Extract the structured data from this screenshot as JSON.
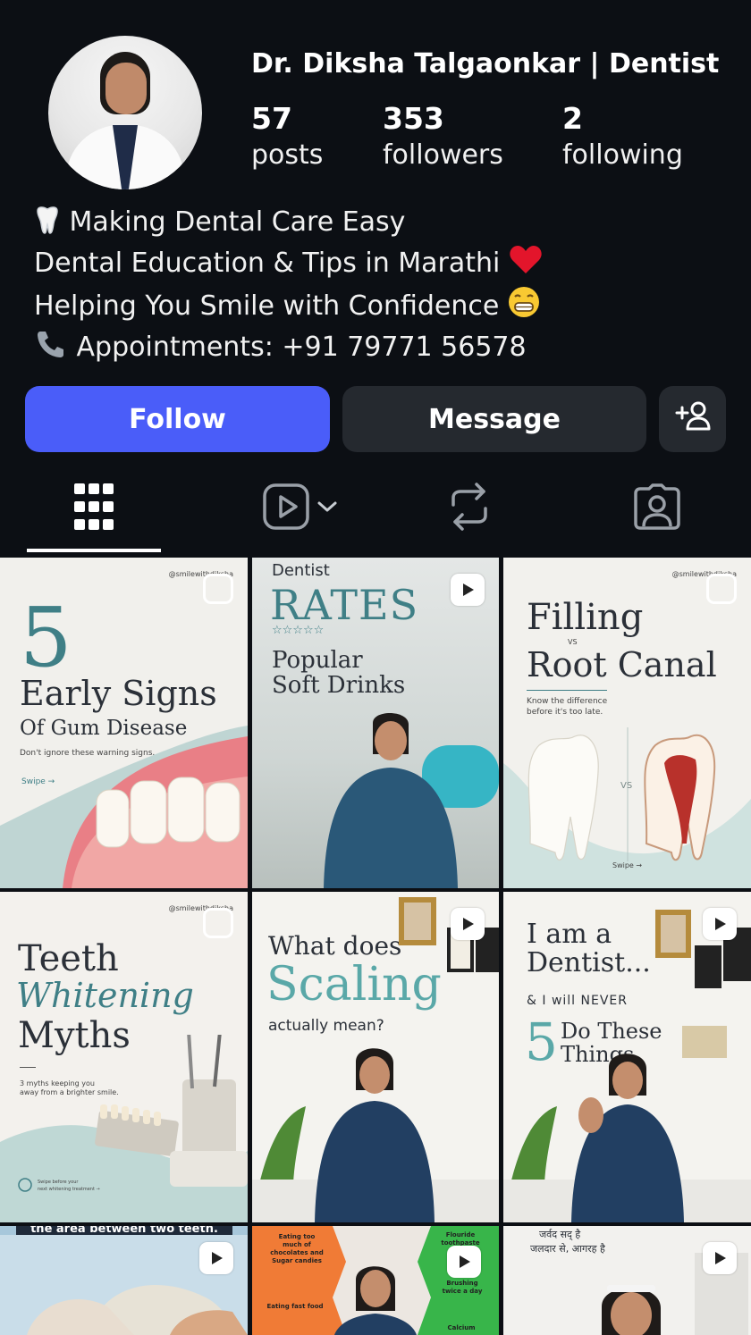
{
  "profile": {
    "name": "Dr. Diksha Talgaonkar | Dentist",
    "stats": [
      {
        "num": "57",
        "label": "posts"
      },
      {
        "num": "353",
        "label": "followers"
      },
      {
        "num": "2",
        "label": "following"
      }
    ],
    "bio": [
      {
        "icon": "tooth-icon",
        "text": " Making Dental Care Easy",
        "suffix": ""
      },
      {
        "icon": "",
        "text": "Dental Education & Tips in Marathi ",
        "suffix": "heart-icon"
      },
      {
        "icon": "",
        "text": "Helping You Smile with Confidence ",
        "suffix": "grin-icon"
      },
      {
        "icon": "phone-icon",
        "text": " Appointments: +91 79771 56578",
        "suffix": ""
      }
    ]
  },
  "actions": {
    "follow_label": "Follow",
    "message_label": "Message",
    "follow_color": "#4a5df9"
  },
  "tabs": {
    "icons": [
      "grid-icon",
      "reels-icon",
      "reposts-icon",
      "tagged-icon"
    ],
    "active": "grid-icon"
  },
  "posts": [
    {
      "type": "carousel",
      "title_num": "5",
      "title": "Early Signs",
      "subtitle": "Of Gum Disease",
      "caption": "Don't ignore these warning signs.",
      "swipe": "Swipe →",
      "handle": "@smilewithdiksha"
    },
    {
      "type": "reel",
      "kicker": "Dentist",
      "title": "RATES",
      "stars": "☆☆☆☆☆",
      "subtitle1": "Popular",
      "subtitle2": "Soft Drinks"
    },
    {
      "type": "carousel",
      "title1": "Filling",
      "vs": "VS",
      "title2": "Root Canal",
      "caption1": "Know the difference",
      "caption2": "before it's too late.",
      "vs2": "VS",
      "swipe": "Swipe →",
      "handle": "@smilewithdiksha"
    },
    {
      "type": "carousel",
      "title1": "Teeth",
      "title2": "Whitening",
      "title3": "Myths",
      "caption1": "3 myths keeping you",
      "caption2": "away from a brighter smile.",
      "footer1": "Swipe before your",
      "footer2": "next whitening treatment →",
      "handle": "@smilewithdiksha"
    },
    {
      "type": "reel",
      "title1": "What does",
      "title2": "Scaling",
      "title3": "actually mean?"
    },
    {
      "type": "reel",
      "title1": "I am a",
      "title2": "Dentist...",
      "line": "& I will NEVER",
      "num": "5",
      "title3": "Do These",
      "title4": "Things"
    },
    {
      "type": "reel",
      "caption": "the area between two teeth."
    },
    {
      "type": "reel",
      "left1": "Eating too much of chocolates and Sugar candies",
      "left2": "Eating fast food",
      "right1": "Flouride toothpaste",
      "right2": "Brushing twice a day",
      "right3": "Calcium"
    },
    {
      "type": "reel",
      "caption1": "जर्वद सद् है",
      "caption2": "जलदार से, आगरह है"
    }
  ]
}
